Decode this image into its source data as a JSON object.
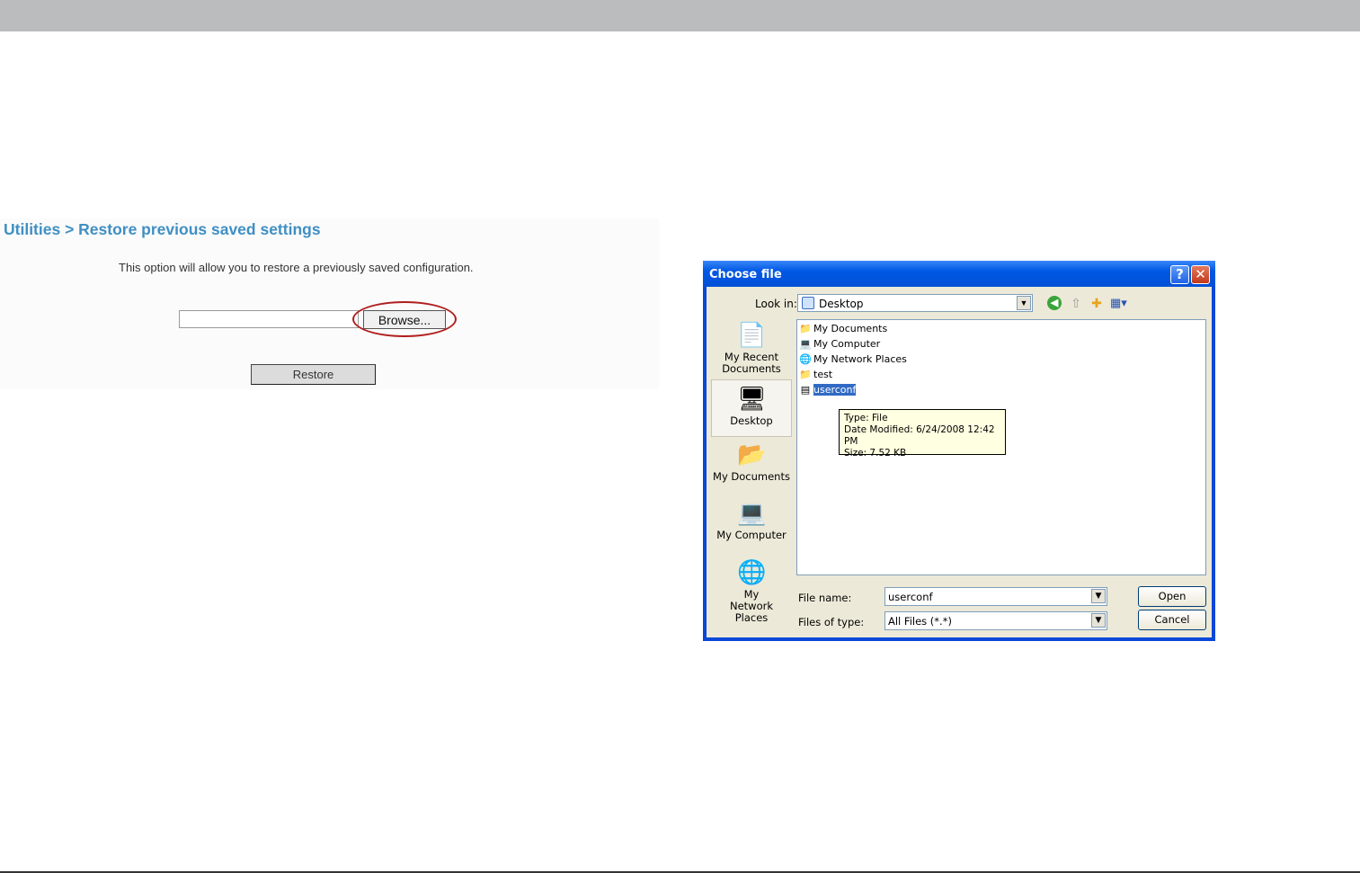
{
  "web": {
    "heading": "Utilities > Restore previous saved settings",
    "description": "This option will allow you to restore a previously saved configuration.",
    "browse_label": "Browse...",
    "restore_label": "Restore"
  },
  "dialog": {
    "title": "Choose file",
    "help_label": "?",
    "close_label": "✕",
    "look_in_label": "Look in:",
    "look_in_value": "Desktop",
    "places": [
      {
        "label": "My Recent Documents",
        "icon": "recent-documents-icon"
      },
      {
        "label": "Desktop",
        "icon": "desktop-icon"
      },
      {
        "label": "My Documents",
        "icon": "my-documents-icon"
      },
      {
        "label": "My Computer",
        "icon": "my-computer-icon"
      },
      {
        "label": "My Network Places",
        "icon": "network-places-icon"
      }
    ],
    "files": [
      {
        "name": "My Documents",
        "icon": "folder-documents-icon"
      },
      {
        "name": "My Computer",
        "icon": "computer-icon"
      },
      {
        "name": "My Network Places",
        "icon": "network-icon"
      },
      {
        "name": "test",
        "icon": "folder-icon"
      },
      {
        "name": "userconf",
        "icon": "file-icon"
      }
    ],
    "tooltip": {
      "type": "Type: File",
      "modified": "Date Modified: 6/24/2008 12:42 PM",
      "size": "Size: 7.52 KB"
    },
    "file_name_label": "File name:",
    "file_name_value": "userconf",
    "files_of_type_label": "Files of type:",
    "files_of_type_value": "All Files (*.*)",
    "open_label": "Open",
    "cancel_label": "Cancel"
  }
}
